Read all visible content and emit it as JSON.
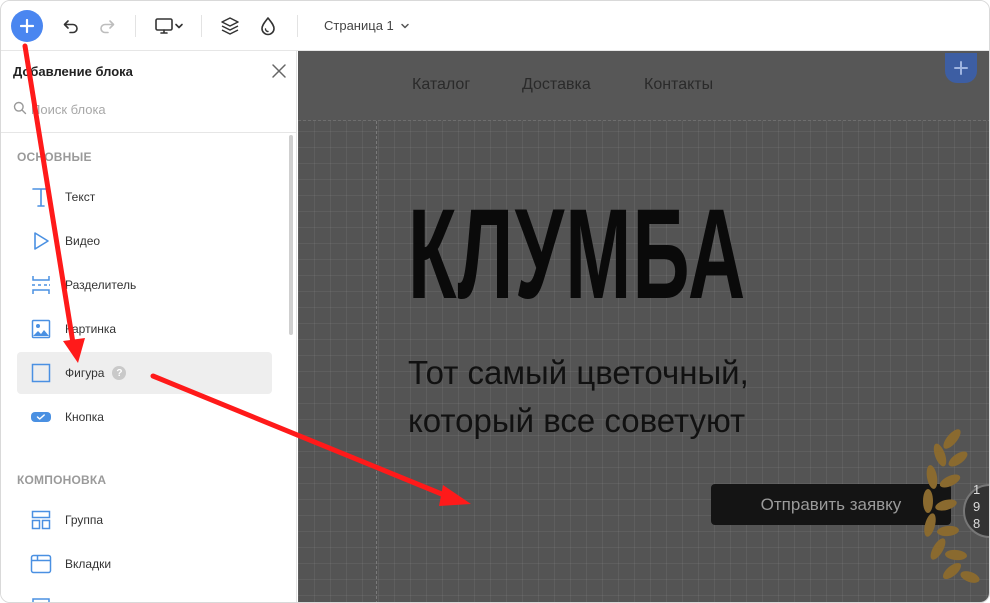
{
  "toolbar": {
    "add_icon": "plus-icon",
    "undo_icon": "undo-icon",
    "redo_icon": "redo-icon",
    "device_icon": "desktop-icon",
    "layers_icon": "layers-icon",
    "theme_icon": "drop-icon",
    "page_select": "Страница 1"
  },
  "panel": {
    "title": "Добавление блока",
    "search_placeholder": "Поиск блока",
    "sections": [
      {
        "label": "ОСНОВНЫЕ",
        "items": [
          {
            "label": "Текст",
            "icon": "text-icon"
          },
          {
            "label": "Видео",
            "icon": "play-icon"
          },
          {
            "label": "Разделитель",
            "icon": "divider-icon"
          },
          {
            "label": "Картинка",
            "icon": "image-icon"
          },
          {
            "label": "Фигура",
            "icon": "square-icon",
            "help": "?"
          },
          {
            "label": "Кнопка",
            "icon": "button-icon"
          }
        ]
      },
      {
        "label": "КОМПОНОВКА",
        "items": [
          {
            "label": "Группа",
            "icon": "group-icon"
          },
          {
            "label": "Вкладки",
            "icon": "tabs-icon"
          }
        ]
      }
    ]
  },
  "canvas": {
    "nav": [
      "Каталог",
      "Доставка",
      "Контакты"
    ],
    "title": "КЛУМБА",
    "subtitle_line1": "Тот самый цветочный,",
    "subtitle_line2": "который все советуют",
    "cta": "Отправить заявку",
    "badge_partial": [
      "1",
      "9",
      "8"
    ]
  },
  "colors": {
    "accent": "#4a86f0",
    "arrow": "#ff1a1a",
    "canvas_bg": "#545454",
    "icon_blue": "#4a90e2"
  }
}
